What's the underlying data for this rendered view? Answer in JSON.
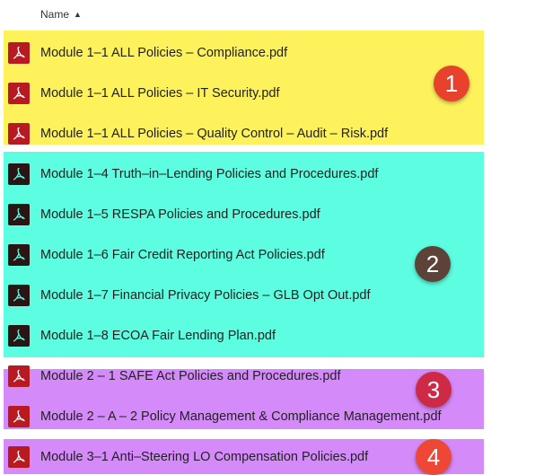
{
  "header": {
    "name_label": "Name",
    "sort_icon": "sort-ascending-icon"
  },
  "files": [
    {
      "name": "Module 1–1 ALL Policies – Compliance.pdf",
      "icon": "pdf-icon"
    },
    {
      "name": "Module 1–1 ALL Policies – IT Security.pdf",
      "icon": "pdf-icon"
    },
    {
      "name": "Module 1–1 ALL Policies – Quality Control – Audit – Risk.pdf",
      "icon": "pdf-icon"
    },
    {
      "name": "Module 1–4 Truth–in–Lending Policies and Procedures.pdf",
      "icon": "pdf-icon"
    },
    {
      "name": "Module 1–5 RESPA Policies and Procedures.pdf",
      "icon": "pdf-icon"
    },
    {
      "name": "Module 1–6 Fair Credit Reporting Act Policies.pdf",
      "icon": "pdf-icon"
    },
    {
      "name": "Module 1–7 Financial Privacy Policies – GLB Opt Out.pdf",
      "icon": "pdf-icon"
    },
    {
      "name": "Module 1–8 ECOA Fair Lending Plan.pdf",
      "icon": "pdf-icon"
    },
    {
      "name": "Module 2 – 1 SAFE Act Policies and Procedures.pdf",
      "icon": "pdf-icon"
    },
    {
      "name": "Module 2 – A – 2 Policy Management & Compliance Management.pdf",
      "icon": "pdf-icon"
    },
    {
      "name": "Module 3–1 Anti–Steering LO Compensation Policies.pdf",
      "icon": "pdf-icon"
    }
  ],
  "groups": [
    {
      "label": "1",
      "color": "#fdf15c"
    },
    {
      "label": "2",
      "color": "#5cfde0"
    },
    {
      "label": "3",
      "color": "#d58afa"
    },
    {
      "label": "4",
      "color": "#d58afa"
    }
  ]
}
